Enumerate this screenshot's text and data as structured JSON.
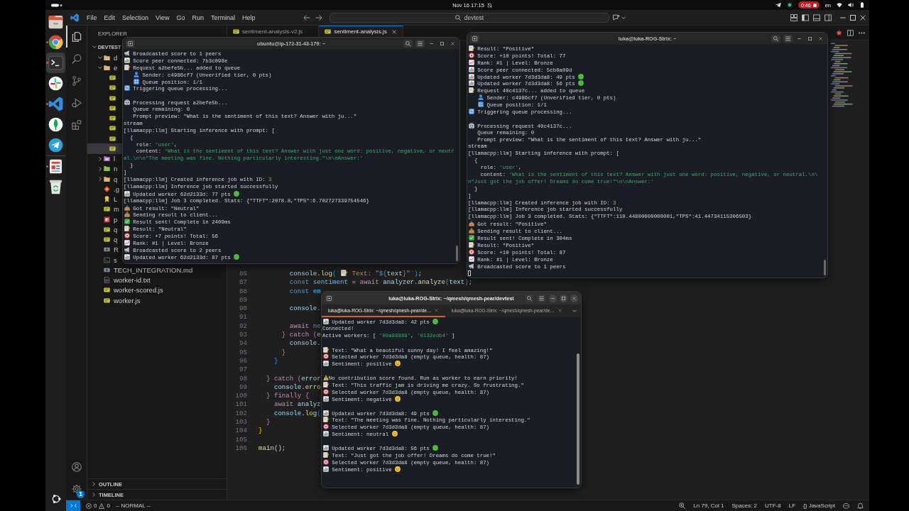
{
  "top_bar": {
    "date": "Nov 16 17:15",
    "recording": "0:46",
    "language": "en"
  },
  "dock": [
    {
      "apps": [
        {
          "kind": "files",
          "running": false,
          "selected": false
        },
        {
          "kind": "browser",
          "running": true,
          "selected": false
        },
        {
          "kind": "terminal",
          "running": true,
          "selected": true
        },
        {
          "kind": "chat",
          "running": false,
          "selected": false
        },
        {
          "kind": "code",
          "running": true,
          "selected": false
        },
        {
          "kind": "leaf",
          "running": false,
          "selected": false
        },
        {
          "kind": "plane",
          "running": false,
          "selected": false
        }
      ]
    },
    {
      "apps": [
        {
          "kind": "document",
          "running": true,
          "selected": false
        },
        {
          "kind": "trash",
          "running": false,
          "selected": false
        }
      ]
    }
  ],
  "vscode": {
    "menu": [
      "File",
      "Edit",
      "Selection",
      "View",
      "Go",
      "Run",
      "Terminal",
      "Help"
    ],
    "command_center": "devtest",
    "activity_bar": [
      {
        "kind": "explorer",
        "selected": true
      },
      {
        "kind": "search",
        "selected": false
      },
      {
        "kind": "source-control",
        "selected": false
      },
      {
        "kind": "run-debug",
        "selected": false
      },
      {
        "kind": "extensions",
        "selected": false
      }
    ],
    "settings_badge": "1",
    "explorer": {
      "title": "EXPLORER",
      "root": {
        "name": "DEVTEST",
        "expanded": true
      },
      "items": [
        {
          "kind": "folder",
          "name": "d",
          "expanded": true,
          "selected": false
        },
        {
          "kind": "folder",
          "name": "e",
          "expanded": true,
          "selected": false,
          "children": [
            {
              "kind": "js",
              "selected": false
            },
            {
              "kind": "js",
              "selected": false
            },
            {
              "kind": "js",
              "selected": false
            },
            {
              "kind": "js",
              "selected": false
            },
            {
              "kind": "js",
              "selected": false
            },
            {
              "kind": "js",
              "selected": false
            },
            {
              "kind": "js",
              "selected": false
            },
            {
              "kind": "js",
              "selected": true
            }
          ]
        },
        {
          "kind": "special-folder",
          "name": "l",
          "expanded": false,
          "selected": false
        },
        {
          "kind": "node-folder",
          "name": "n",
          "expanded": false,
          "selected": false
        },
        {
          "kind": "folder",
          "name": "q",
          "expanded": false,
          "selected": false
        },
        {
          "kind": "git",
          "name": ".g",
          "selected": false
        },
        {
          "kind": "license",
          "name": "L",
          "selected": false
        },
        {
          "kind": "js",
          "name": "m",
          "selected": false
        },
        {
          "kind": "npm",
          "name": "p",
          "selected": false
        },
        {
          "kind": "js",
          "name": "q",
          "selected": false
        },
        {
          "kind": "js",
          "name": "q",
          "selected": false
        },
        {
          "kind": "markdown",
          "name": "R",
          "selected": false
        },
        {
          "kind": "shell",
          "name": "s",
          "selected": false
        },
        {
          "kind": "markdown",
          "name": "TECH_INTEGRATION.md",
          "selected": false
        },
        {
          "kind": "text",
          "name": "worker-id.txt",
          "selected": false
        },
        {
          "kind": "js",
          "name": "worker-scored.js",
          "selected": false
        },
        {
          "kind": "js",
          "name": "worker.js",
          "selected": false
        }
      ]
    },
    "panels": [
      {
        "title": "OUTLINE",
        "expanded": false
      },
      {
        "title": "TIMELINE",
        "expanded": false
      }
    ],
    "tabs": [
      {
        "label": "sentiment-analysis-v2.js",
        "kind": "js",
        "selected": false
      },
      {
        "label": "sentiment-analysis.js",
        "kind": "js",
        "selected": true
      }
    ],
    "code": [
      {
        "number": "86",
        "tokens": [
          {
            "text": "        console",
            "kind": "var"
          },
          {
            "text": ".",
            "kind": "p"
          },
          {
            "text": "log",
            "kind": "fn"
          },
          {
            "text": "(",
            "kind": "br3"
          },
          {
            "text": "`",
            "kind": "str"
          },
          {
            "kind": "emoji"
          },
          {
            "text": " Text: \"",
            "kind": "str"
          },
          {
            "text": "${",
            "kind": "kw"
          },
          {
            "text": "text",
            "kind": "var"
          },
          {
            "text": "}",
            "kind": "kw"
          },
          {
            "text": "\"`",
            "kind": "str"
          },
          {
            "text": ")",
            "kind": "br3"
          },
          {
            "text": ";",
            "kind": "p"
          }
        ]
      },
      {
        "number": "87",
        "tokens": [
          {
            "text": "        const",
            "kind": "kw"
          },
          {
            "text": " sentiment",
            "kind": "const"
          },
          {
            "text": " = ",
            "kind": "p"
          },
          {
            "text": "await",
            "kind": "ctrl"
          },
          {
            "text": " analyzer",
            "kind": "var"
          },
          {
            "text": ".",
            "kind": "p"
          },
          {
            "text": "analyze",
            "kind": "fn"
          },
          {
            "text": "(",
            "kind": "br3"
          },
          {
            "text": "text",
            "kind": "var"
          },
          {
            "text": ")",
            "kind": "br3"
          },
          {
            "text": ";",
            "kind": "p"
          }
        ]
      },
      {
        "number": "88",
        "tokens": [
          {
            "text": "        const",
            "kind": "kw"
          },
          {
            "text": " em",
            "kind": "const"
          }
        ]
      },
      {
        "number": "89"
      },
      {
        "number": "90",
        "tokens": [
          {
            "text": "        console",
            "kind": "var"
          },
          {
            "text": ".",
            "kind": "p"
          }
        ]
      },
      {
        "number": "91"
      },
      {
        "number": "92",
        "tokens": [
          {
            "text": "        await",
            "kind": "ctrl"
          },
          {
            "text": " ne",
            "kind": "kw"
          }
        ]
      },
      {
        "number": "93",
        "tokens": [
          {
            "text": "      }",
            "kind": "br2"
          },
          {
            "text": " catch",
            "kind": "ctrl"
          },
          {
            "text": " (",
            "kind": "br2"
          },
          {
            "text": "e",
            "kind": "var"
          }
        ]
      },
      {
        "number": "94",
        "tokens": [
          {
            "text": "        console",
            "kind": "var"
          },
          {
            "text": ".",
            "kind": "p"
          }
        ]
      },
      {
        "number": "95",
        "tokens": [
          {
            "text": "      }",
            "kind": "br2"
          }
        ]
      },
      {
        "number": "96",
        "tokens": [
          {
            "text": "    }",
            "kind": "br3"
          }
        ]
      },
      {
        "number": "97"
      },
      {
        "number": "98",
        "tokens": [
          {
            "text": "  }",
            "kind": "br2"
          },
          {
            "text": " catch",
            "kind": "ctrl"
          },
          {
            "text": " (",
            "kind": "br2"
          },
          {
            "text": "error",
            "kind": "var"
          }
        ]
      },
      {
        "number": "99",
        "tokens": [
          {
            "text": "    console",
            "kind": "var"
          },
          {
            "text": ".",
            "kind": "p"
          },
          {
            "text": "erro",
            "kind": "fn"
          }
        ]
      },
      {
        "number": "100",
        "tokens": [
          {
            "text": "  }",
            "kind": "br2"
          },
          {
            "text": " finally",
            "kind": "ctrl"
          },
          {
            "text": " {",
            "kind": "br2"
          }
        ]
      },
      {
        "number": "101",
        "tokens": [
          {
            "text": "    await",
            "kind": "ctrl"
          },
          {
            "text": " analyz",
            "kind": "var"
          }
        ]
      },
      {
        "number": "102",
        "tokens": [
          {
            "text": "    console",
            "kind": "var"
          },
          {
            "text": ".",
            "kind": "p"
          },
          {
            "text": "log",
            "kind": "fn"
          },
          {
            "text": "(",
            "kind": "br3"
          }
        ]
      },
      {
        "number": "103",
        "tokens": [
          {
            "text": "  }",
            "kind": "br2"
          }
        ]
      },
      {
        "number": "104",
        "tokens": [
          {
            "text": "}",
            "kind": "br1"
          }
        ]
      },
      {
        "number": "105"
      },
      {
        "number": "106",
        "tokens": [
          {
            "text": "main",
            "kind": "fn"
          },
          {
            "text": "();",
            "kind": "p"
          }
        ]
      }
    ],
    "status_bar": {
      "errors": "0",
      "warnings": "0",
      "mode": "-- NORMAL --",
      "position": "Ln 79, Col 1",
      "indentation": "Spaces: 2",
      "encoding": "UTF-8",
      "line_ending": "LF",
      "language": "{} JavaScript"
    }
  },
  "terminals": [
    {
      "title": "ubuntu@ip-172-31-43-179: ~",
      "focused": false,
      "cursor": false,
      "blocks": [
        {
          "lines": [
            {
              "kind": "broadcast",
              "text": "Broadcasted score to 1 peers"
            },
            {
              "kind": "peer",
              "text": "Score peer connected: 7b3c098e"
            },
            {
              "kind": "request",
              "text": "Request a2befe5b... added to queue"
            },
            {
              "kind": "sender",
              "text": "   Sender: c4986cf7 (Unverified tier, 0 pts)"
            },
            {
              "kind": "position",
              "text": "   Queue position: 1/1"
            },
            {
              "kind": "trigger",
              "text": "Triggering queue processing..."
            }
          ]
        },
        {
          "lines": [
            {
              "kind": "processing",
              "text": "Processing request a2befe5b..."
            },
            {
              "kind": "plain",
              "text": "   Queue remaining: 0"
            },
            {
              "kind": "plain",
              "text": "   Prompt preview: \"What is the sentiment of this text? Answer with ju...\""
            },
            {
              "kind": "plain",
              "text": "stream"
            },
            {
              "kind": "plain",
              "text": "[llamacpp:llm] Starting inference with prompt: ["
            },
            {
              "kind": "plain",
              "text": "  {"
            },
            {
              "kind": "plain",
              "parts": [
                {
                  "text": "    role: ",
                  "kind": "plain"
                },
                {
                  "text": "'user'",
                  "kind": "string"
                },
                {
                  "text": ",",
                  "kind": "plain"
                }
              ]
            },
            {
              "kind": "plain",
              "parts": [
                {
                  "text": "    content: ",
                  "kind": "plain"
                },
                {
                  "text": "'What is the sentiment of this text? Answer with just one word: positive, negative, or neutr",
                  "kind": "string"
                }
              ]
            },
            {
              "kind": "plain",
              "parts": [
                {
                  "text": "al.\\n\\n\"The meeting was fine. Nothing particularly interesting.\"\\n\\nAnswer:'",
                  "kind": "string"
                }
              ]
            },
            {
              "kind": "plain",
              "text": "  }"
            },
            {
              "kind": "plain",
              "text": "]"
            },
            {
              "kind": "plain",
              "parts": [
                {
                  "text": "[llamacpp:llm] Created inference job with ID: ",
                  "kind": "plain"
                },
                {
                  "text": "3",
                  "kind": "number"
                }
              ]
            },
            {
              "kind": "plain",
              "text": "[llamacpp:llm] Inference job started successfully"
            },
            {
              "kind": "update",
              "text": "Updated worker 62d2133d: 77 pts"
            },
            {
              "kind": "plain",
              "text": "[llamacpp:llm] Job 3 completed. Stats: {\"TTFT\":2078.8,\"TPS\":6.702727339754546}"
            },
            {
              "kind": "received",
              "text": "Got result: \"Neutral\""
            },
            {
              "kind": "sending",
              "text": "Sending result to client..."
            },
            {
              "kind": "sent",
              "text": "Result sent! Complete in 2409ms"
            },
            {
              "kind": "result",
              "text": "Result: \"Neutral\""
            },
            {
              "kind": "score",
              "text": "Score: +7 points! Total: 56"
            },
            {
              "kind": "rank",
              "text": "Rank: #1 | Level: Bronze"
            },
            {
              "kind": "broadcast",
              "text": "Broadcasted score to 2 peers"
            },
            {
              "kind": "update",
              "text": "Updated worker 62d2133d: 87 pts"
            }
          ]
        }
      ]
    },
    {
      "title": "luka@luka-ROG-Strix: ~",
      "focused": false,
      "cursor": true,
      "blocks": [
        {
          "lines": [
            {
              "kind": "result",
              "text": "Result: \"Positive\""
            },
            {
              "kind": "score",
              "text": "Score: +10 points! Total: 77"
            },
            {
              "kind": "rank",
              "text": "Rank: #1 | Level: Bronze"
            },
            {
              "kind": "peer",
              "text": "Score peer connected: 5cb0a09d"
            },
            {
              "kind": "update",
              "text": "Updated worker 7d3d3da8: 49 pts"
            },
            {
              "kind": "update",
              "text": "Updated worker 7d3d3da8: 56 pts"
            },
            {
              "kind": "request",
              "text": "Request 40c4137c... added to queue"
            },
            {
              "kind": "sender",
              "text": "   Sender: c4986cf7 (Unverified tier, 0 pts)"
            },
            {
              "kind": "position",
              "text": "   Queue position: 1/1"
            },
            {
              "kind": "trigger",
              "text": "Triggering queue processing..."
            }
          ]
        },
        {
          "lines": [
            {
              "kind": "processing",
              "text": "Processing request 40c4137c..."
            },
            {
              "kind": "plain",
              "text": "   Queue remaining: 0"
            },
            {
              "kind": "plain",
              "text": "   Prompt preview: \"What is the sentiment of this text? Answer with ju...\""
            },
            {
              "kind": "plain",
              "text": "stream"
            },
            {
              "kind": "plain",
              "text": "[llamacpp:llm] Starting inference with prompt: ["
            },
            {
              "kind": "plain",
              "text": "  {"
            },
            {
              "kind": "plain",
              "parts": [
                {
                  "text": "    role: ",
                  "kind": "plain"
                },
                {
                  "text": "'user'",
                  "kind": "string"
                },
                {
                  "text": ",",
                  "kind": "plain"
                }
              ]
            },
            {
              "kind": "plain",
              "parts": [
                {
                  "text": "    content: ",
                  "kind": "plain"
                },
                {
                  "text": "'What is the sentiment of this text? Answer with just one word: positive, negative, or neutral.\\n\\",
                  "kind": "string"
                }
              ]
            },
            {
              "kind": "plain",
              "parts": [
                {
                  "text": "n\"Just got the job offer! Dreams do come true!\"\\n\\nAnswer:'",
                  "kind": "string"
                }
              ]
            },
            {
              "kind": "plain",
              "text": "  }"
            },
            {
              "kind": "plain",
              "text": "]"
            },
            {
              "kind": "plain",
              "parts": [
                {
                  "text": "[llamacpp:llm] Created inference job with ID: ",
                  "kind": "plain"
                },
                {
                  "text": "3",
                  "kind": "number"
                }
              ]
            },
            {
              "kind": "plain",
              "text": "[llamacpp:llm] Inference job started successfully"
            },
            {
              "kind": "plain",
              "text": "[llamacpp:llm] Job 3 completed. Stats: {\"TTFT\":110.44800000000001,\"TPS\":41.44734115306503}"
            },
            {
              "kind": "received",
              "text": "Got result: \"Positive\""
            },
            {
              "kind": "sending",
              "text": "Sending result to client..."
            },
            {
              "kind": "sent",
              "text": "Result sent! Complete in 304ms"
            },
            {
              "kind": "result",
              "text": "Result: \"Positive\""
            },
            {
              "kind": "score",
              "text": "Score: +10 points! Total: 87"
            },
            {
              "kind": "rank",
              "text": "Rank: #1 | Level: Bronze"
            },
            {
              "kind": "broadcast",
              "text": "Broadcasted score to 1 peers"
            }
          ]
        }
      ]
    },
    {
      "title": "luka@luka-ROG-Strix: ~/qmesh/qmesh-pear/devtest",
      "focused": true,
      "cursor": false,
      "tabs": [
        {
          "label": "luka@luka-ROG-Strix: ~/qmesh/qmesh-pear/de…",
          "selected": true
        },
        {
          "label": "luka@luka-ROG-Strix: ~/qmesh/qmesh-pear/de…",
          "selected": false
        }
      ],
      "blocks": [
        {
          "lines": [
            {
              "kind": "update",
              "text": "Updated worker 7d3d3da8: 42 pts"
            },
            {
              "kind": "plain",
              "text": "Connected!"
            },
            {
              "kind": "plain",
              "parts": [
                {
                  "text": "Active workers: [ ",
                  "kind": "plain"
                },
                {
                  "text": "'00a98889'",
                  "kind": "string"
                },
                {
                  "text": ", ",
                  "kind": "plain"
                },
                {
                  "text": "'0132edb4'",
                  "kind": "string"
                },
                {
                  "text": " ]",
                  "kind": "plain"
                }
              ]
            }
          ]
        },
        {
          "lines": [
            {
              "kind": "text",
              "text": "Text: \"What a beautiful sunny day! I feel amazing!\""
            },
            {
              "kind": "selected",
              "text": "Selected worker 7d3d3da8 (empty queue, health: 87)"
            },
            {
              "kind": "positive",
              "text": "Sentiment: positive"
            }
          ]
        },
        {
          "lines": [
            {
              "kind": "warning",
              "text": "No contribution score found. Run as worker to earn priority!"
            },
            {
              "kind": "text",
              "text": "Text: \"This traffic jam is driving me crazy. So frustrating.\""
            },
            {
              "kind": "selected",
              "text": "Selected worker 7d3d3da8 (empty queue, health: 87)"
            },
            {
              "kind": "negative",
              "text": "Sentiment: negative"
            }
          ]
        },
        {
          "lines": [
            {
              "kind": "update",
              "text": "Updated worker 7d3d3da8: 49 pts"
            },
            {
              "kind": "text",
              "text": "Text: \"The meeting was fine. Nothing particularly interesting.\""
            },
            {
              "kind": "selected",
              "text": "Selected worker 7d3d3da8 (empty queue, health: 87)"
            },
            {
              "kind": "neutral",
              "text": "Sentiment: neutral"
            }
          ]
        },
        {
          "lines": [
            {
              "kind": "update",
              "text": "Updated worker 7d3d3da8: 56 pts"
            },
            {
              "kind": "text",
              "text": "Text: \"Just got the job offer! Dreams do come true!\""
            },
            {
              "kind": "selected",
              "text": "Selected worker 7d3d3da8 (empty queue, health: 87)"
            },
            {
              "kind": "positive",
              "text": "Sentiment: positive"
            }
          ]
        }
      ]
    }
  ]
}
